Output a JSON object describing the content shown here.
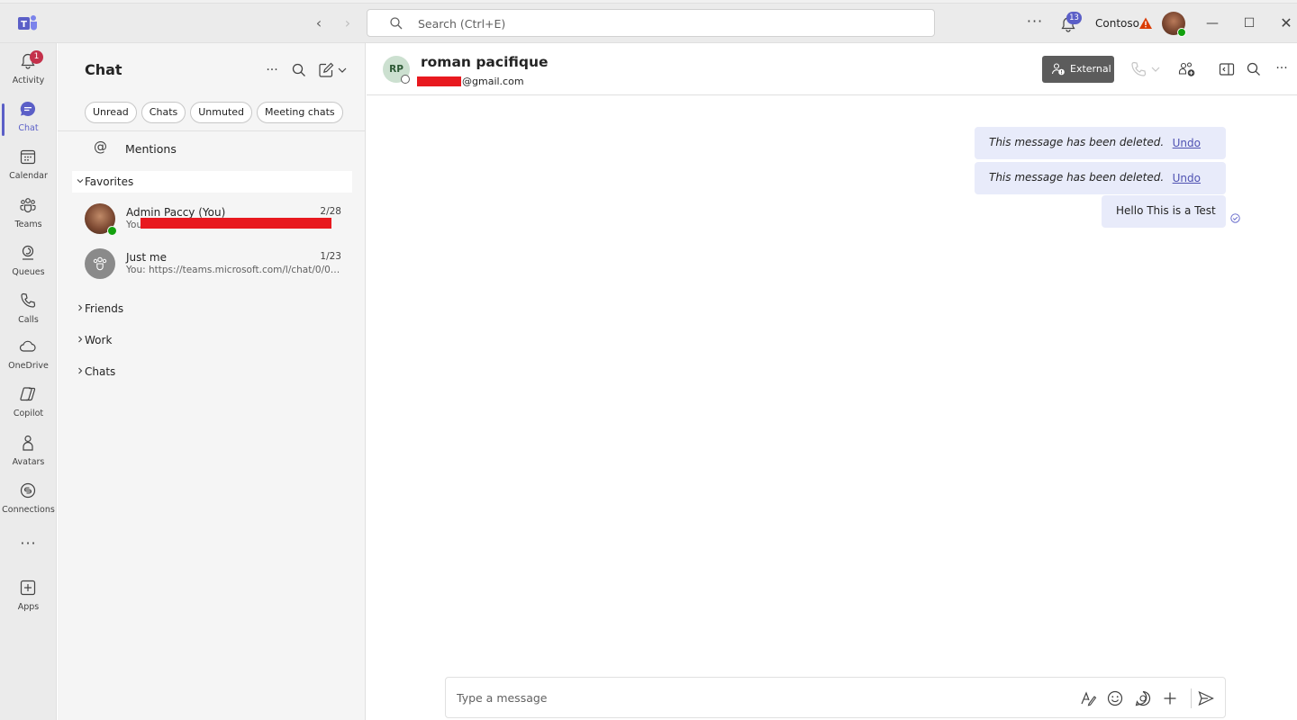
{
  "titlebar": {
    "search_placeholder": "Search (Ctrl+E)",
    "notifications_count": "13",
    "org_name": "Contoso"
  },
  "rail": {
    "items": [
      {
        "label": "Activity",
        "badge": "1"
      },
      {
        "label": "Chat"
      },
      {
        "label": "Calendar"
      },
      {
        "label": "Teams"
      },
      {
        "label": "Queues"
      },
      {
        "label": "Calls"
      },
      {
        "label": "OneDrive"
      },
      {
        "label": "Copilot"
      },
      {
        "label": "Avatars"
      },
      {
        "label": "Connections"
      },
      {
        "label": "Apps"
      }
    ],
    "more": "···"
  },
  "chatpane": {
    "title": "Chat",
    "filters": [
      "Unread",
      "Chats",
      "Unmuted",
      "Meeting chats"
    ],
    "mentions_label": "Mentions",
    "favorites_label": "Favorites",
    "chats": [
      {
        "name": "Admin Paccy (You)",
        "date": "2/28",
        "preview": "You:"
      },
      {
        "name": "Just me",
        "date": "1/23",
        "preview": "You: https://teams.microsoft.com/l/chat/0/0?u..."
      }
    ],
    "groups": [
      "Friends",
      "Work",
      "Chats"
    ]
  },
  "conversation": {
    "initials": "RP",
    "name": "roman pacifique",
    "email_suffix": "@gmail.com",
    "external_label": "External",
    "messages": [
      {
        "text": "This message has been deleted.",
        "undo": "Undo"
      },
      {
        "text": "This message has been deleted.",
        "undo": "Undo"
      },
      {
        "text": "Hello This is a Test"
      }
    ],
    "composer_placeholder": "Type a message"
  },
  "colors": {
    "accent": "#5b5fc7",
    "bubble": "#e8ebfa",
    "badge_red": "#c4314b",
    "redaction": "#e8191f"
  }
}
